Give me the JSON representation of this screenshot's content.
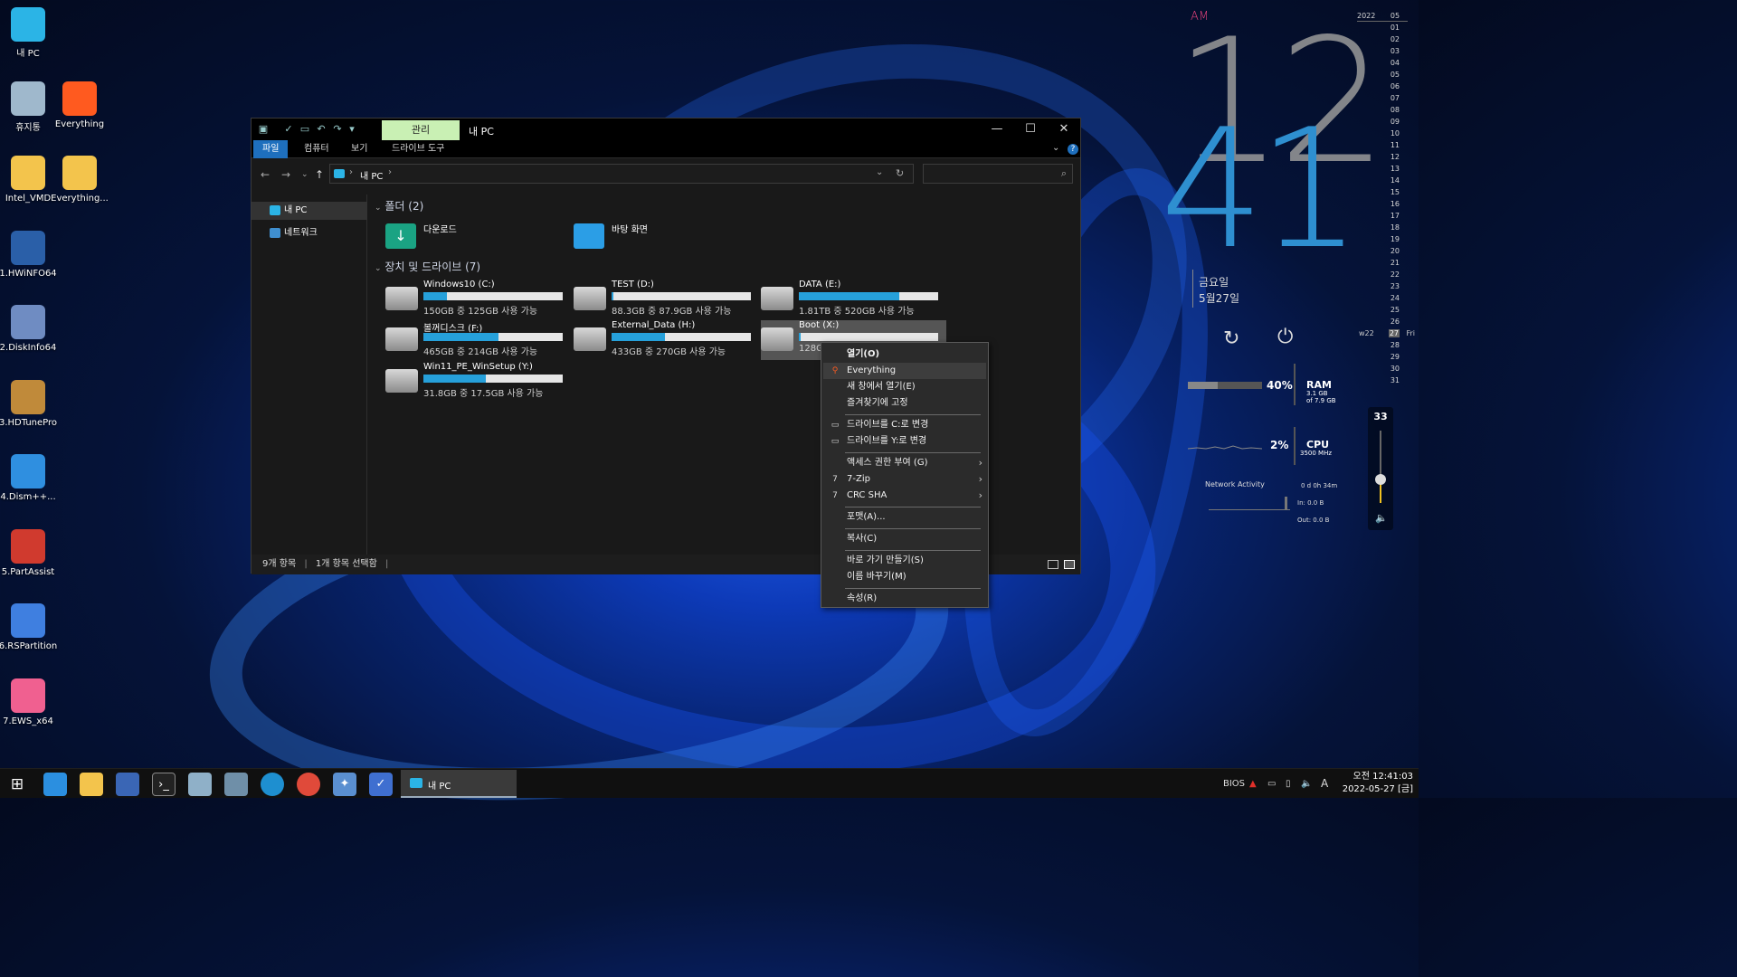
{
  "desktop_icons": [
    {
      "label": "내 PC",
      "icon": "monitor-icon",
      "color": "#2bb4e6"
    },
    {
      "label": "휴지통",
      "icon": "recycle-bin-icon",
      "color": "#9fb8cc"
    },
    {
      "label": "Everything",
      "icon": "magnifier-icon",
      "color": "#ff5a1f"
    },
    {
      "label": "Intel_VMD",
      "icon": "folder-icon",
      "color": "#f3c44c"
    },
    {
      "label": "Everything...",
      "icon": "folder-icon",
      "color": "#f3c44c"
    },
    {
      "label": "1.HWiNFO64",
      "icon": "hwinfo-icon",
      "color": "#2a5fa8"
    },
    {
      "label": "2.DiskInfo64",
      "icon": "diskinfo-icon",
      "color": "#6f8cc2"
    },
    {
      "label": "3.HDTunePro",
      "icon": "hdtune-icon",
      "color": "#c08a3a"
    },
    {
      "label": "4.Dism++...",
      "icon": "gear-icon",
      "color": "#2f8fe0"
    },
    {
      "label": "5.PartAssist",
      "icon": "partassist-icon",
      "color": "#d03a2e"
    },
    {
      "label": "6.RSPartition",
      "icon": "rspartition-icon",
      "color": "#3f7fe0"
    },
    {
      "label": "7.EWS_x64",
      "icon": "windows-icon",
      "color": "#f06090"
    }
  ],
  "explorer": {
    "title": "내 PC",
    "context_tab": "관리",
    "ribbon_tabs": [
      "파일",
      "컴퓨터",
      "보기",
      "드라이브 도구"
    ],
    "address_path": "내 PC",
    "nav_items": [
      {
        "label": "내 PC",
        "selected": true
      },
      {
        "label": "네트워크",
        "selected": false
      }
    ],
    "folders_header": "폴더 (2)",
    "folders": [
      {
        "name": "다운로드",
        "icon": "download-folder-icon",
        "color": "#1aa383"
      },
      {
        "name": "바탕 화면",
        "icon": "desktop-folder-icon",
        "color": "#2b9ee6"
      }
    ],
    "drives_header": "장치 및 드라이브 (7)",
    "drives": [
      {
        "name": "Windows10 (C:)",
        "free": "150GB 중 125GB 사용 가능",
        "used_fraction": 0.17,
        "icon": "windows-drive-icon"
      },
      {
        "name": "TEST (D:)",
        "free": "88.3GB 중 87.9GB 사용 가능",
        "used_fraction": 0.01,
        "icon": "drive-icon"
      },
      {
        "name": "DATA (E:)",
        "free": "1.81TB 중 520GB 사용 가능",
        "used_fraction": 0.72,
        "icon": "drive-icon"
      },
      {
        "name": "볼꺼디스크 (F:)",
        "free": "465GB 중 214GB 사용 가능",
        "used_fraction": 0.54,
        "icon": "drive-icon"
      },
      {
        "name": "External_Data (H:)",
        "free": "433GB 중 270GB 사용 가능",
        "used_fraction": 0.38,
        "icon": "usb-drive-icon"
      },
      {
        "name": "Boot (X:)",
        "free": "128GB",
        "used_fraction": 0.01,
        "icon": "windows-drive-icon"
      },
      {
        "name": "Win11_PE_WinSetup (Y:)",
        "free": "31.8GB 중 17.5GB 사용 가능",
        "used_fraction": 0.45,
        "icon": "usb-drive-icon"
      }
    ],
    "status_items": "9개 항목",
    "status_selected": "1개 항목 선택함"
  },
  "context_menu": {
    "items": [
      {
        "label": "열기(O)",
        "bold": true
      },
      {
        "label": "Everything",
        "icon": "everything-icon",
        "highlight": true
      },
      {
        "label": "새 창에서 열기(E)"
      },
      {
        "label": "즐겨찾기에 고정"
      },
      {
        "separator": true
      },
      {
        "label": "드라이브를 C:로 변경",
        "icon": "drive-swap-icon"
      },
      {
        "label": "드라이브를 Y:로 변경",
        "icon": "drive-swap-icon"
      },
      {
        "separator": true
      },
      {
        "label": "액세스 권한 부여 (G)",
        "submenu": true
      },
      {
        "label": "7-Zip",
        "icon": "7zip-icon",
        "submenu": true
      },
      {
        "label": "CRC SHA",
        "icon": "7zip-icon",
        "submenu": true
      },
      {
        "separator": true
      },
      {
        "label": "포맷(A)..."
      },
      {
        "separator": true
      },
      {
        "label": "복사(C)"
      },
      {
        "separator": true
      },
      {
        "label": "바로 가기 만들기(S)"
      },
      {
        "label": "이름 바꾸기(M)"
      },
      {
        "separator": true
      },
      {
        "label": "속성(R)"
      }
    ]
  },
  "clock_widget": {
    "ampm": "AM",
    "hour": "12",
    "minute": "41",
    "weekday": "금요일",
    "date": "5월27일",
    "ram_percent": "40%",
    "ram_label": "RAM",
    "ram_detail_1": "3.1 GB",
    "ram_detail_2": "of 7.9 GB",
    "ram_fraction": 0.4,
    "cpu_percent": "2%",
    "cpu_label": "CPU",
    "cpu_detail": "3500 MHz",
    "network_label": "Network Activity",
    "uptime": "0 d 0h 34m",
    "net_in": "In: 0.0 B",
    "net_out": "Out: 0.0 B",
    "volume": "33",
    "volume_fraction": 0.33,
    "calendar_year": "2022",
    "calendar_month": "05",
    "calendar_days": [
      "01",
      "02",
      "03",
      "04",
      "05",
      "06",
      "07",
      "08",
      "09",
      "10",
      "11",
      "12",
      "13",
      "14",
      "15",
      "16",
      "17",
      "18",
      "19",
      "20",
      "21",
      "22",
      "23",
      "24",
      "25",
      "26",
      "27",
      "28",
      "29",
      "30",
      "31"
    ],
    "week_label": "w22",
    "today": "27",
    "today_weekday": "Fri",
    "colors": {
      "minute": "#2e8fd0",
      "hour": "#9a9a9a",
      "ampm": "#e0407a"
    }
  },
  "taskbar": {
    "window_label": "내 PC",
    "tray_text": "BIOS",
    "ime": "A",
    "time": "오전 12:41:03",
    "date": "2022-05-27 [금]"
  }
}
